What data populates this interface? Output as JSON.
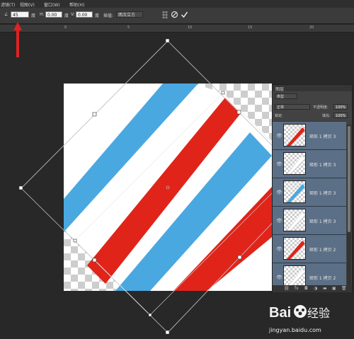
{
  "menubar": {
    "items": [
      "滤镜(T)",
      "视图(V)",
      "窗口(W)",
      "帮助(H)"
    ]
  },
  "options": {
    "angle_icon": "angle-icon",
    "angle_value": "45",
    "angle_unit": "度",
    "h_label": "H:",
    "h_value": "0.00",
    "h_unit": "度",
    "v_label": "V:",
    "v_value": "0.00",
    "v_unit": "度",
    "interp_label": "插值:",
    "interp_value": "两次立方",
    "warp_icon": "warp-icon",
    "cancel_icon": "cancel-icon",
    "commit_icon": "checkmark-icon"
  },
  "ruler": {
    "ticks": [
      "0",
      "5",
      "10",
      "15",
      "20"
    ]
  },
  "canvas": {
    "stripe_colors": [
      "#4aa8e0",
      "#e0241a"
    ],
    "checker_colors": [
      "#ffffff",
      "#cccccc"
    ]
  },
  "layers_panel": {
    "tab_label": "图层",
    "filter_label": "类型",
    "blend_mode": "正常",
    "opacity_label": "不透明度:",
    "opacity_value": "100%",
    "lock_label": "锁定:",
    "fill_label": "填充:",
    "fill_value": "100%",
    "layers": [
      {
        "name": "矩形 1 拷贝 3",
        "stripe": "red"
      },
      {
        "name": "矩形 1 拷贝 3",
        "stripe": "white"
      },
      {
        "name": "矩形 1 拷贝 3",
        "stripe": "blue"
      },
      {
        "name": "矩形 1 拷贝 3",
        "stripe": "white"
      },
      {
        "name": "矩形 1 拷贝 2",
        "stripe": "red"
      },
      {
        "name": "矩形 1 拷贝 2",
        "stripe": "white"
      }
    ],
    "footer_icons": [
      "link-icon",
      "fx-icon",
      "mask-icon",
      "adjustment-icon",
      "group-icon",
      "new-layer-icon",
      "trash-icon"
    ]
  },
  "watermark": {
    "brand": "Baidu经验",
    "url": "jingyan.baidu.com"
  }
}
